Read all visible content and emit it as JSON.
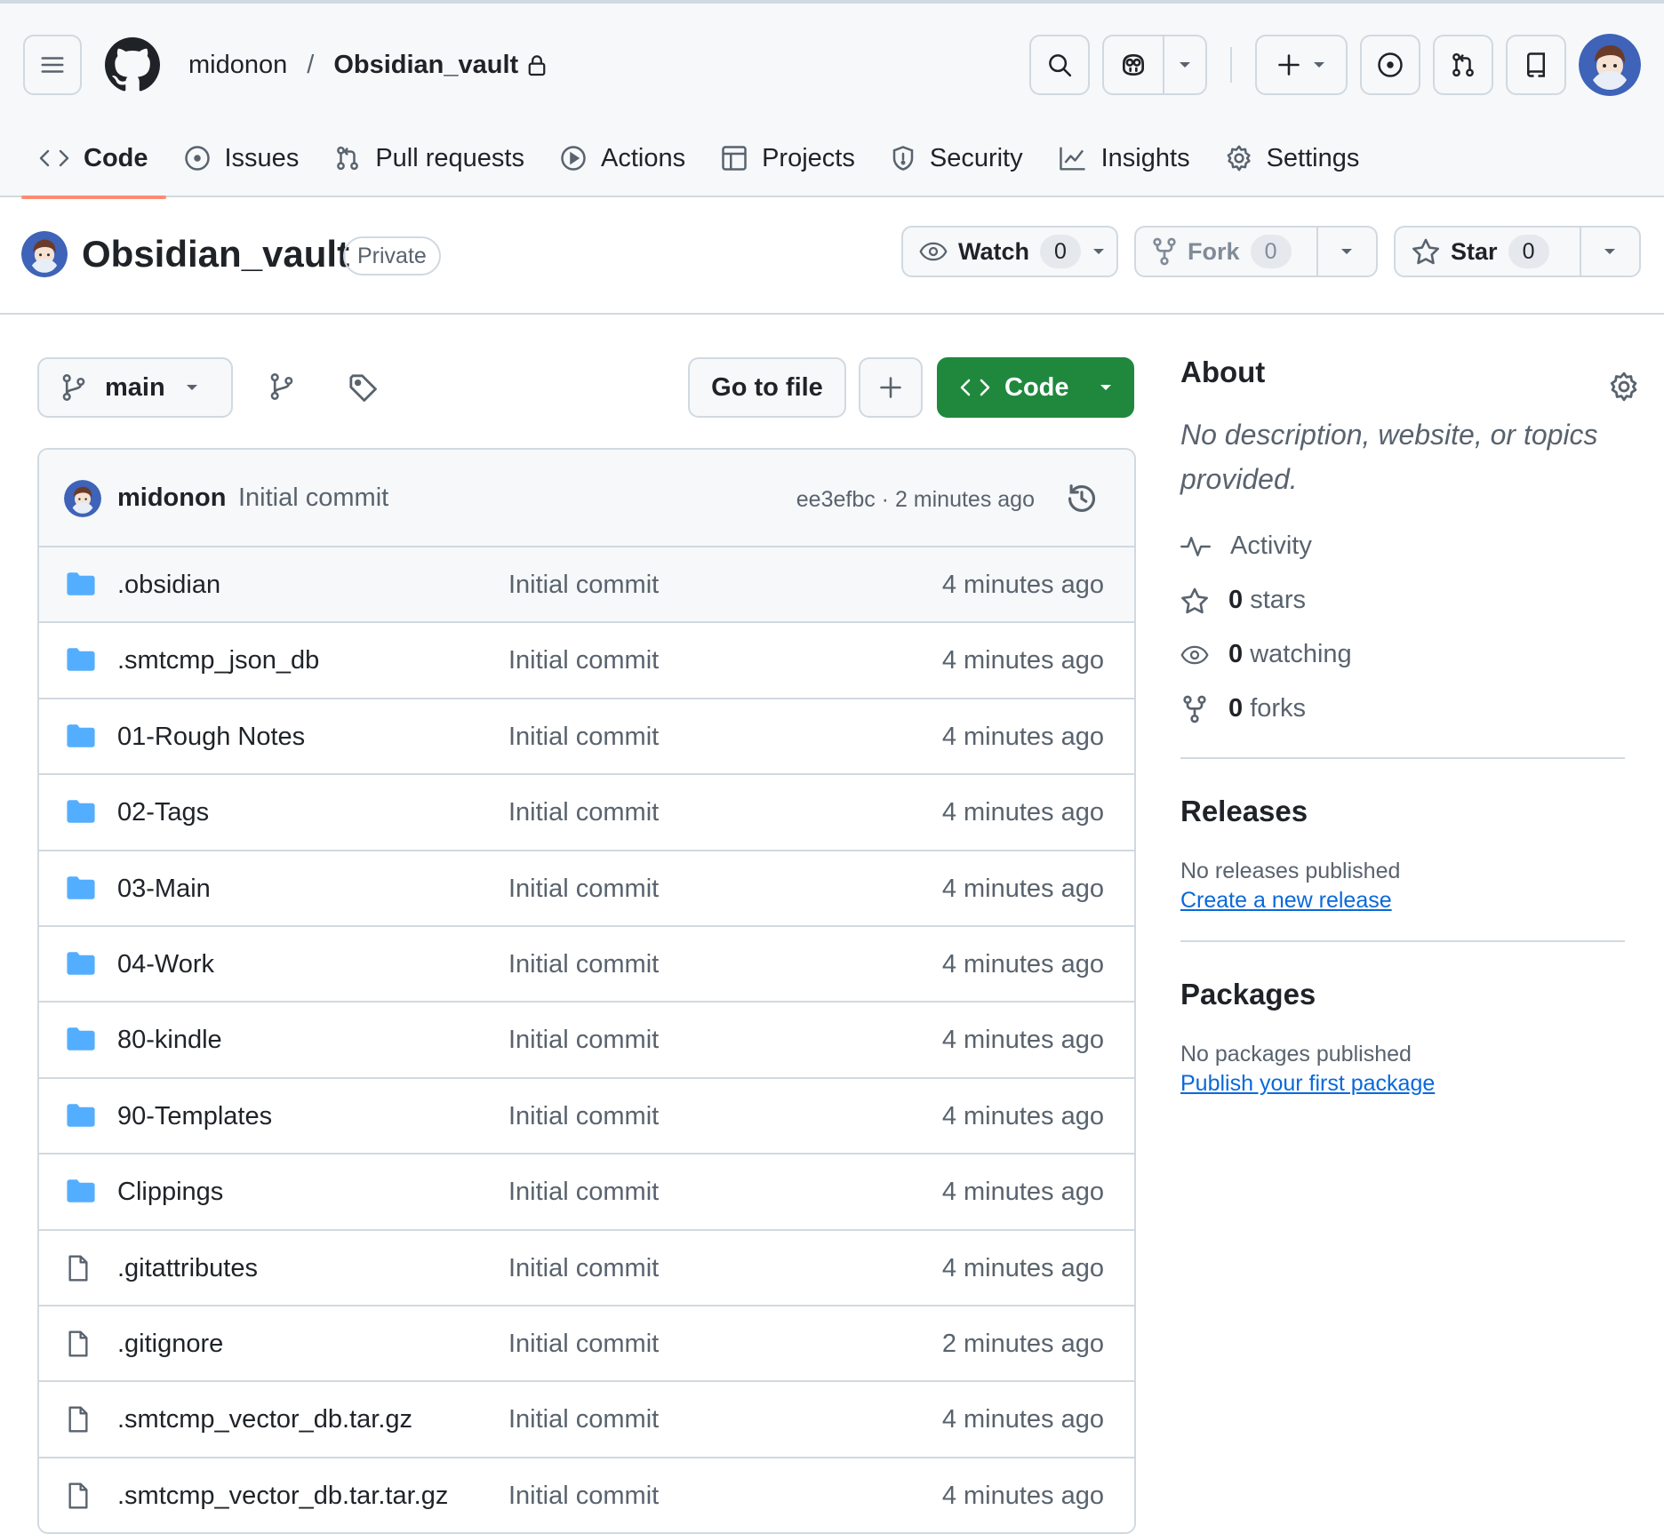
{
  "header": {
    "owner": "midonon",
    "separator": "/",
    "repo": "Obsidian_vault",
    "tabs": [
      {
        "label": "Code"
      },
      {
        "label": "Issues"
      },
      {
        "label": "Pull requests"
      },
      {
        "label": "Actions"
      },
      {
        "label": "Projects"
      },
      {
        "label": "Security"
      },
      {
        "label": "Insights"
      },
      {
        "label": "Settings"
      }
    ]
  },
  "repo": {
    "title": "Obsidian_vault",
    "visibility": "Private",
    "watch": {
      "label": "Watch",
      "count": "0"
    },
    "fork": {
      "label": "Fork",
      "count": "0"
    },
    "star": {
      "label": "Star",
      "count": "0"
    }
  },
  "toolbar": {
    "branch": "main",
    "go_to_file": "Go to file",
    "code_label": "Code"
  },
  "commit": {
    "author": "midonon",
    "message": "Initial commit",
    "meta": "ee3efbc · 2 minutes ago"
  },
  "files": [
    {
      "name": ".obsidian",
      "type": "folder",
      "message": "Initial commit",
      "age": "4 minutes ago"
    },
    {
      "name": ".smtcmp_json_db",
      "type": "folder",
      "message": "Initial commit",
      "age": "4 minutes ago"
    },
    {
      "name": "01-Rough Notes",
      "type": "folder",
      "message": "Initial commit",
      "age": "4 minutes ago"
    },
    {
      "name": "02-Tags",
      "type": "folder",
      "message": "Initial commit",
      "age": "4 minutes ago"
    },
    {
      "name": "03-Main",
      "type": "folder",
      "message": "Initial commit",
      "age": "4 minutes ago"
    },
    {
      "name": "04-Work",
      "type": "folder",
      "message": "Initial commit",
      "age": "4 minutes ago"
    },
    {
      "name": "80-kindle",
      "type": "folder",
      "message": "Initial commit",
      "age": "4 minutes ago"
    },
    {
      "name": "90-Templates",
      "type": "folder",
      "message": "Initial commit",
      "age": "4 minutes ago"
    },
    {
      "name": "Clippings",
      "type": "folder",
      "message": "Initial commit",
      "age": "4 minutes ago"
    },
    {
      "name": ".gitattributes",
      "type": "file",
      "message": "Initial commit",
      "age": "4 minutes ago"
    },
    {
      "name": ".gitignore",
      "type": "file",
      "message": "Initial commit",
      "age": "2 minutes ago"
    },
    {
      "name": ".smtcmp_vector_db.tar.gz",
      "type": "file",
      "message": "Initial commit",
      "age": "4 minutes ago"
    },
    {
      "name": ".smtcmp_vector_db.tar.tar.gz",
      "type": "file",
      "message": "Initial commit",
      "age": "4 minutes ago"
    }
  ],
  "about": {
    "title": "About",
    "description": "No description, website, or topics provided.",
    "activity": "Activity",
    "stars_count": "0",
    "stars_label": "stars",
    "watching_count": "0",
    "watching_label": "watching",
    "forks_count": "0",
    "forks_label": "forks"
  },
  "releases": {
    "title": "Releases",
    "text": "No releases published",
    "link": "Create a new release"
  },
  "packages": {
    "title": "Packages",
    "text": "No packages published",
    "link": "Publish your first package"
  },
  "colors": {
    "accent_green": "#1f883d",
    "folder_blue": "#54aeff",
    "link_blue": "#0969da",
    "tab_underline": "#fd8c73"
  }
}
